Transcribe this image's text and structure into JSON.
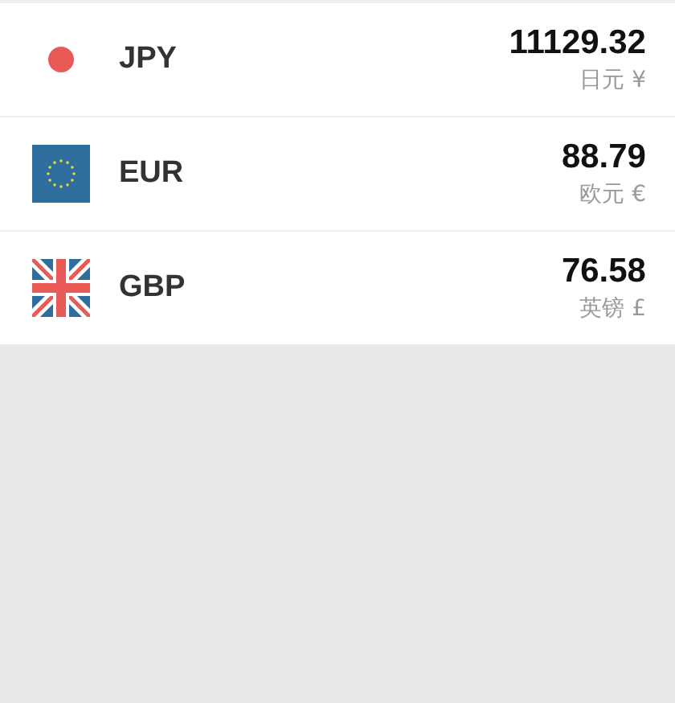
{
  "currencies": [
    {
      "kind": "jp",
      "code": "JPY",
      "amount": "11129.32",
      "name": "日元 ¥"
    },
    {
      "kind": "eu",
      "code": "EUR",
      "amount": "88.79",
      "name": "欧元 €"
    },
    {
      "kind": "gb",
      "code": "GBP",
      "amount": "76.58",
      "name": "英镑 £"
    }
  ]
}
